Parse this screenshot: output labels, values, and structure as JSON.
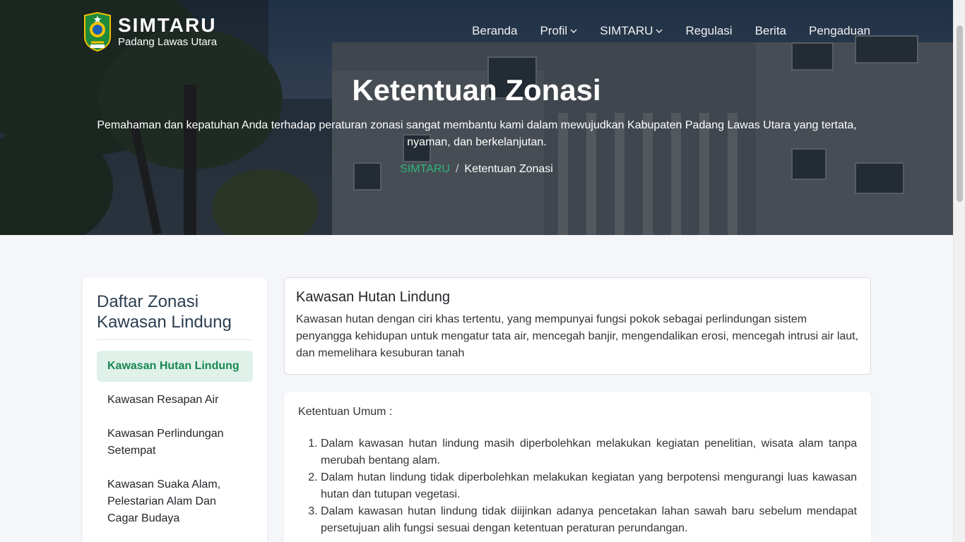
{
  "header": {
    "brand_title": "SIMTARU",
    "brand_subtitle": "Padang Lawas Utara",
    "nav": [
      {
        "label": "Beranda",
        "has_dropdown": false
      },
      {
        "label": "Profil",
        "has_dropdown": true
      },
      {
        "label": "SIMTARU",
        "has_dropdown": true
      },
      {
        "label": "Regulasi",
        "has_dropdown": false
      },
      {
        "label": "Berita",
        "has_dropdown": false
      },
      {
        "label": "Pengaduan",
        "has_dropdown": false
      }
    ]
  },
  "hero": {
    "title": "Ketentuan Zonasi",
    "description": "Pemahaman dan kepatuhan Anda terhadap peraturan zonasi sangat membantu kami dalam mewujudkan Kabupaten Padang Lawas Utara yang tertata, nyaman, dan berkelanjutan.",
    "breadcrumb": {
      "link": "SIMTARU",
      "separator": "/",
      "current": "Ketentuan Zonasi"
    }
  },
  "sidebar": {
    "title": "Daftar Zonasi Kawasan Lindung",
    "items": [
      {
        "label": "Kawasan Hutan Lindung",
        "active": true
      },
      {
        "label": "Kawasan Resapan Air",
        "active": false
      },
      {
        "label": "Kawasan Perlindungan Setempat",
        "active": false
      },
      {
        "label": "Kawasan Suaka Alam, Pelestarian Alam Dan Cagar Budaya",
        "active": false
      }
    ]
  },
  "zone": {
    "title": "Kawasan Hutan Lindung",
    "description": "Kawasan hutan dengan ciri khas tertentu, yang mempunyai fungsi pokok sebagai perlindungan sistem penyangga kehidupan untuk mengatur tata air, mencegah banjir, mengendalikan erosi, mencegah intrusi air laut, dan memelihara kesuburan tanah"
  },
  "rules": {
    "lead": "Ketentuan Umum :",
    "items": [
      "Dalam kawasan hutan lindung masih diperbolehkan melakukan kegiatan penelitian, wisata alam tanpa merubah bentang alam.",
      "Dalam hutan lindung tidak diperbolehkan melakukan kegiatan yang berpotensi mengurangi luas kawasan hutan dan tutupan vegetasi.",
      "Dalam kawasan hutan lindung tidak diijinkan adanya pencetakan lahan sawah baru sebelum mendapat persetujuan alih fungsi sesuai dengan ketentuan peraturan perundangan."
    ]
  },
  "colors": {
    "accent_green": "#198754",
    "active_bg": "#dff1e8",
    "breadcrumb_link": "#2fb47a"
  }
}
